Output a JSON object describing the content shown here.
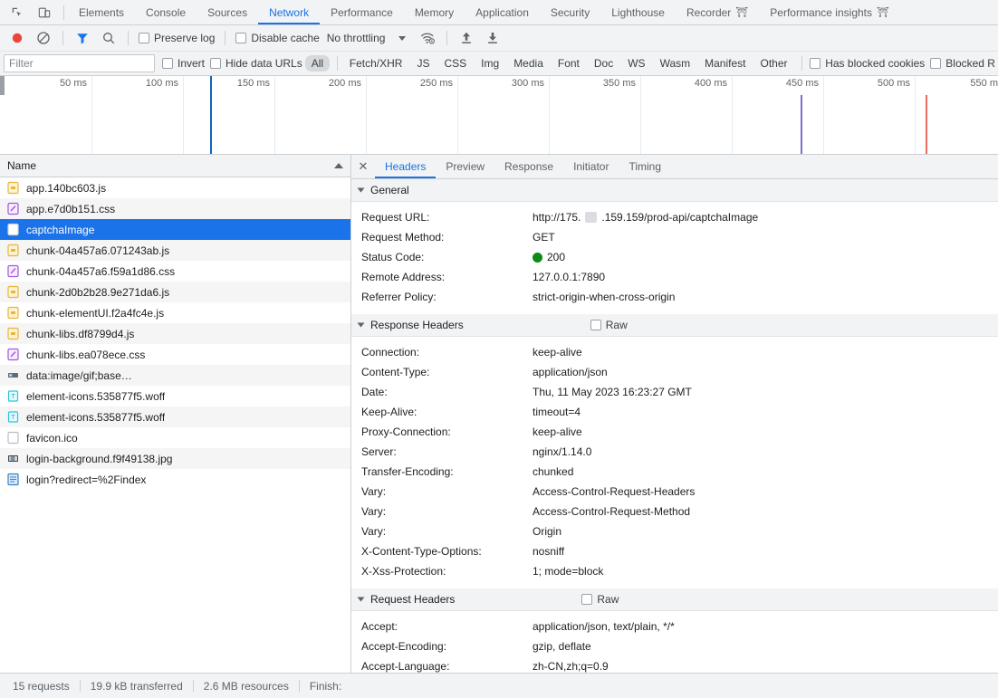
{
  "window": {
    "inspect_icon": "inspect-element-icon",
    "device_icon": "device-toolbar-icon"
  },
  "tabs": [
    {
      "label": "Elements",
      "active": false,
      "flask": false
    },
    {
      "label": "Console",
      "active": false,
      "flask": false
    },
    {
      "label": "Sources",
      "active": false,
      "flask": false
    },
    {
      "label": "Network",
      "active": true,
      "flask": false
    },
    {
      "label": "Performance",
      "active": false,
      "flask": false
    },
    {
      "label": "Memory",
      "active": false,
      "flask": false
    },
    {
      "label": "Application",
      "active": false,
      "flask": false
    },
    {
      "label": "Security",
      "active": false,
      "flask": false
    },
    {
      "label": "Lighthouse",
      "active": false,
      "flask": false
    },
    {
      "label": "Recorder",
      "active": false,
      "flask": true
    },
    {
      "label": "Performance insights",
      "active": false,
      "flask": true
    }
  ],
  "toolbar": {
    "record_icon": "record-button-icon",
    "clear_icon": "clear-network-log-icon",
    "filter_icon": "filter-icon",
    "search_icon": "search-icon",
    "preserve_log_label": "Preserve log",
    "preserve_log_checked": false,
    "disable_cache_label": "Disable cache",
    "disable_cache_checked": false,
    "throttling_label": "No throttling",
    "network_conditions_icon": "network-conditions-wifi-icon",
    "import_icon": "import-har-icon",
    "export_icon": "export-har-icon"
  },
  "filterbar": {
    "placeholder": "Filter",
    "value": "",
    "invert_label": "Invert",
    "invert_checked": false,
    "hide_data_urls_label": "Hide data URLs",
    "hide_data_urls_checked": false,
    "types": [
      {
        "label": "All",
        "selected": true
      },
      {
        "label": "Fetch/XHR",
        "selected": false
      },
      {
        "label": "JS",
        "selected": false
      },
      {
        "label": "CSS",
        "selected": false
      },
      {
        "label": "Img",
        "selected": false
      },
      {
        "label": "Media",
        "selected": false
      },
      {
        "label": "Font",
        "selected": false
      },
      {
        "label": "Doc",
        "selected": false
      },
      {
        "label": "WS",
        "selected": false
      },
      {
        "label": "Wasm",
        "selected": false
      },
      {
        "label": "Manifest",
        "selected": false
      },
      {
        "label": "Other",
        "selected": false
      }
    ],
    "has_blocked_cookies_label": "Has blocked cookies",
    "has_blocked_cookies_checked": false,
    "blocked_requests_label": "Blocked R",
    "blocked_requests_checked": false
  },
  "overview": {
    "ticks": [
      "50 ms",
      "100 ms",
      "150 ms",
      "200 ms",
      "250 ms",
      "300 ms",
      "350 ms",
      "400 ms",
      "450 ms",
      "500 ms",
      "550 m"
    ]
  },
  "requests": {
    "column_header": "Name",
    "sort_direction": "asc",
    "rows": [
      {
        "name": "app.140bc603.js",
        "type": "js",
        "selected": false
      },
      {
        "name": "app.e7d0b151.css",
        "type": "css",
        "selected": false
      },
      {
        "name": "captchaImage",
        "type": "other",
        "selected": true
      },
      {
        "name": "chunk-04a457a6.071243ab.js",
        "type": "js",
        "selected": false
      },
      {
        "name": "chunk-04a457a6.f59a1d86.css",
        "type": "css",
        "selected": false
      },
      {
        "name": "chunk-2d0b2b28.9e271da6.js",
        "type": "js",
        "selected": false
      },
      {
        "name": "chunk-elementUI.f2a4fc4e.js",
        "type": "js",
        "selected": false
      },
      {
        "name": "chunk-libs.df8799d4.js",
        "type": "js",
        "selected": false
      },
      {
        "name": "chunk-libs.ea078ece.css",
        "type": "css",
        "selected": false
      },
      {
        "name": "data:image/gif;base…",
        "type": "img-small",
        "selected": false
      },
      {
        "name": "element-icons.535877f5.woff",
        "type": "font",
        "selected": false
      },
      {
        "name": "element-icons.535877f5.woff",
        "type": "font",
        "selected": false
      },
      {
        "name": "favicon.ico",
        "type": "other",
        "selected": false
      },
      {
        "name": "login-background.f9f49138.jpg",
        "type": "img",
        "selected": false
      },
      {
        "name": "login?redirect=%2Findex",
        "type": "doc",
        "selected": false
      }
    ]
  },
  "detail": {
    "close_label": "✕",
    "tabs": [
      {
        "label": "Headers",
        "active": true
      },
      {
        "label": "Preview",
        "active": false
      },
      {
        "label": "Response",
        "active": false
      },
      {
        "label": "Initiator",
        "active": false
      },
      {
        "label": "Timing",
        "active": false
      }
    ],
    "general": {
      "title": "General",
      "rows": [
        {
          "key": "Request URL:",
          "value_prefix": "http://175.",
          "redacted": true,
          "value_suffix": ".159.159/prod-api/captchaImage"
        },
        {
          "key": "Request Method:",
          "value": "GET"
        },
        {
          "key": "Status Code:",
          "value": "200",
          "dot": "#0e8a16"
        },
        {
          "key": "Remote Address:",
          "value": "127.0.0.1:7890"
        },
        {
          "key": "Referrer Policy:",
          "value": "strict-origin-when-cross-origin"
        }
      ]
    },
    "response_headers": {
      "title": "Response Headers",
      "raw_label": "Raw",
      "raw_checked": false,
      "rows": [
        {
          "key": "Connection:",
          "value": "keep-alive"
        },
        {
          "key": "Content-Type:",
          "value": "application/json"
        },
        {
          "key": "Date:",
          "value": "Thu, 11 May 2023 16:23:27 GMT"
        },
        {
          "key": "Keep-Alive:",
          "value": "timeout=4"
        },
        {
          "key": "Proxy-Connection:",
          "value": "keep-alive"
        },
        {
          "key": "Server:",
          "value": "nginx/1.14.0"
        },
        {
          "key": "Transfer-Encoding:",
          "value": "chunked"
        },
        {
          "key": "Vary:",
          "value": "Access-Control-Request-Headers"
        },
        {
          "key": "Vary:",
          "value": "Access-Control-Request-Method"
        },
        {
          "key": "Vary:",
          "value": "Origin"
        },
        {
          "key": "X-Content-Type-Options:",
          "value": "nosniff"
        },
        {
          "key": "X-Xss-Protection:",
          "value": "1; mode=block"
        }
      ]
    },
    "request_headers": {
      "title": "Request Headers",
      "raw_label": "Raw",
      "raw_checked": false,
      "rows": [
        {
          "key": "Accept:",
          "value": "application/json, text/plain, */*"
        },
        {
          "key": "Accept-Encoding:",
          "value": "gzip, deflate"
        },
        {
          "key": "Accept-Language:",
          "value": "zh-CN,zh;q=0.9"
        }
      ]
    }
  },
  "statusbar": {
    "requests": "15 requests",
    "transferred": "19.9 kB transferred",
    "resources": "2.6 MB resources",
    "finish": "Finish:"
  },
  "colors": {
    "accent": "#1a73e8",
    "record_active": "#e8453c",
    "status_ok": "#0e8a16",
    "bar_green": "#00a352",
    "bar_blue": "#29a7ff",
    "chrome_bg": "#f1f3f4"
  }
}
